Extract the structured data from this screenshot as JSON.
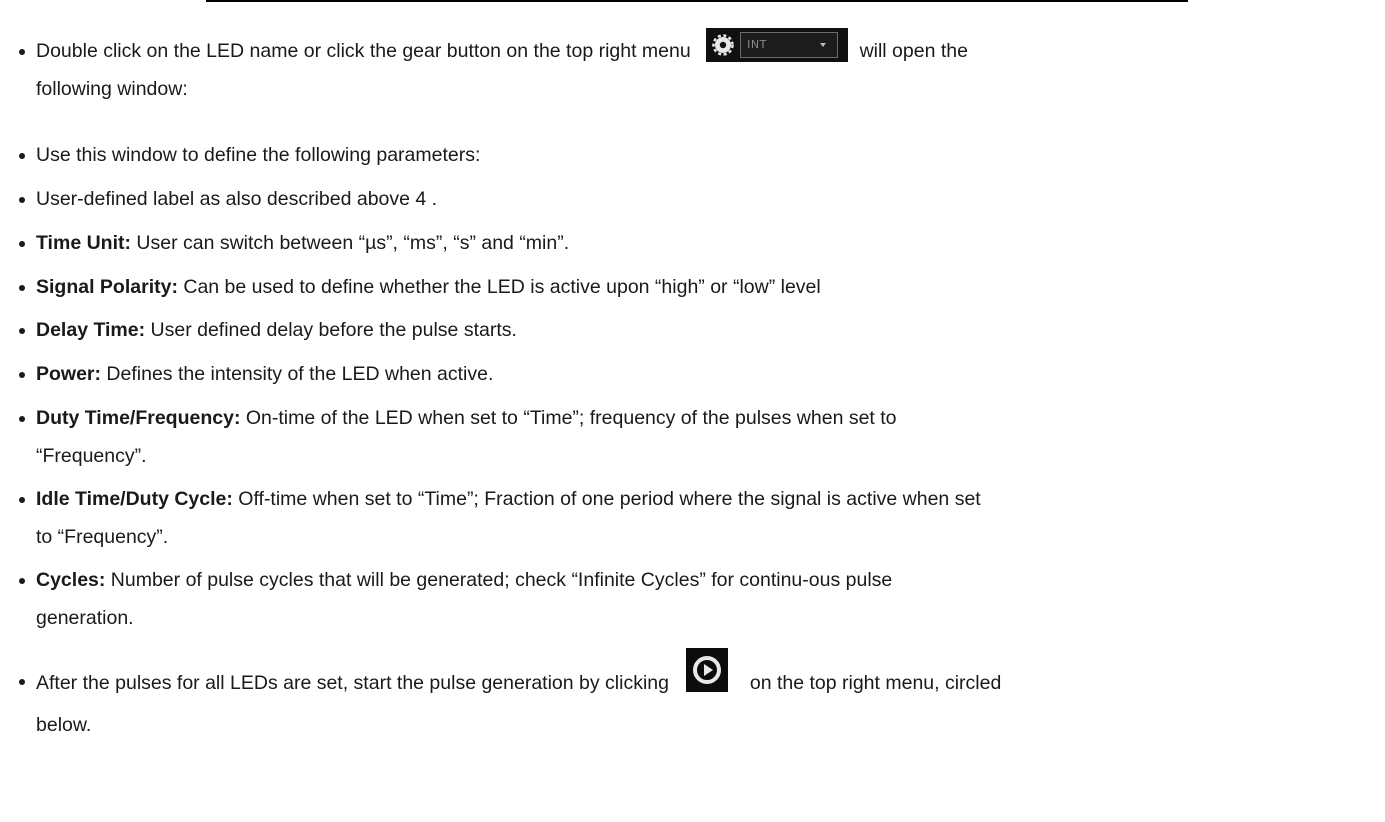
{
  "gear_widget": {
    "mode_label": "INT"
  },
  "items": [
    {
      "before": "Double click on the LED name or click the gear button on the top right menu",
      "after": "will open the",
      "continuation": "following window:"
    },
    {
      "text": "Use this window to define the following parameters:"
    },
    {
      "text": "User-defined label as also described above 4 ."
    },
    {
      "term": "Time Unit:",
      "line1": " User can switch between “µs”, “ms”, “s” and “min”."
    },
    {
      "term": "Signal Polarity:",
      "line1": " Can be used to define whether the LED is active upon “high” or “low” level"
    },
    {
      "term": "Delay Time:",
      "line1": " User defined delay before the pulse starts."
    },
    {
      "term": "Power:",
      "line1": " Defines the intensity of the LED when active."
    },
    {
      "term": "Duty Time/Frequency:",
      "line1": " On-time of the LED when set to “Time”; frequency of the pulses when set to",
      "line2": "“Frequency”."
    },
    {
      "term": "Idle Time/Duty Cycle:",
      "line1": " Off-time when set to “Time”; Fraction of one period where the signal is active when set",
      "line2": "to “Frequency”."
    },
    {
      "term": "Cycles:",
      "line1": " Number of pulse cycles that will be generated; check “Infinite Cycles” for continu-ous pulse",
      "line2": "generation."
    },
    {
      "before": "After the pulses for all LEDs are set, start the pulse generation by clicking",
      "after": "on the top right menu, circled",
      "continuation": "below."
    }
  ]
}
